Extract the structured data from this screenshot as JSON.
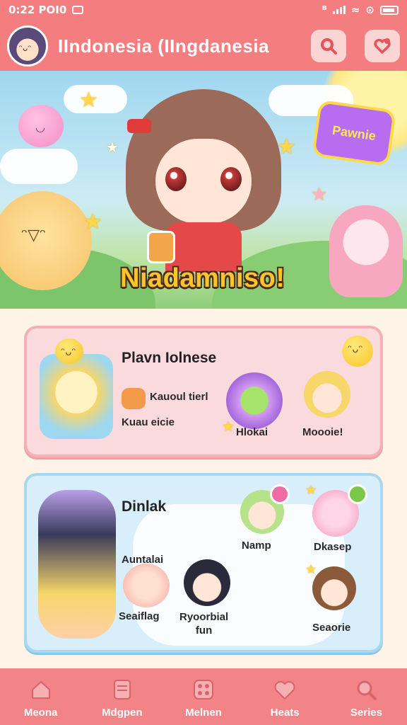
{
  "status_bar": {
    "time": "0:22 POI0"
  },
  "header": {
    "title": "IIndonesia (IIngdanesia"
  },
  "hero": {
    "title": "Niadamniso!",
    "badge": "Pawnie"
  },
  "card_primary": {
    "title": "Plavn Iolnese",
    "line1": "Kauoul tierl",
    "line2": "Kuau eicie",
    "items": [
      {
        "label": "Hlokai"
      },
      {
        "label": "Moooie!"
      }
    ]
  },
  "card_secondary": {
    "title": "Dinlak",
    "sub": "Auntalai",
    "items": [
      {
        "label": "Namp"
      },
      {
        "label": "Dkasep"
      },
      {
        "label": "Seaiflag"
      },
      {
        "label": "Ryoorbial\nfun"
      },
      {
        "label": "Seaorie"
      }
    ]
  },
  "nav": [
    {
      "label": "Meona",
      "icon": "home-icon"
    },
    {
      "label": "Mdgpen",
      "icon": "book-icon"
    },
    {
      "label": "Melnen",
      "icon": "games-icon"
    },
    {
      "label": "Heats",
      "icon": "heart-icon"
    },
    {
      "label": "Series",
      "icon": "search-icon"
    }
  ],
  "colors": {
    "header": "#f47d80",
    "nav": "#f28488",
    "card_primary": "#fadadd",
    "card_secondary": "#d8eefa",
    "title_yellow": "#f9c42e"
  }
}
